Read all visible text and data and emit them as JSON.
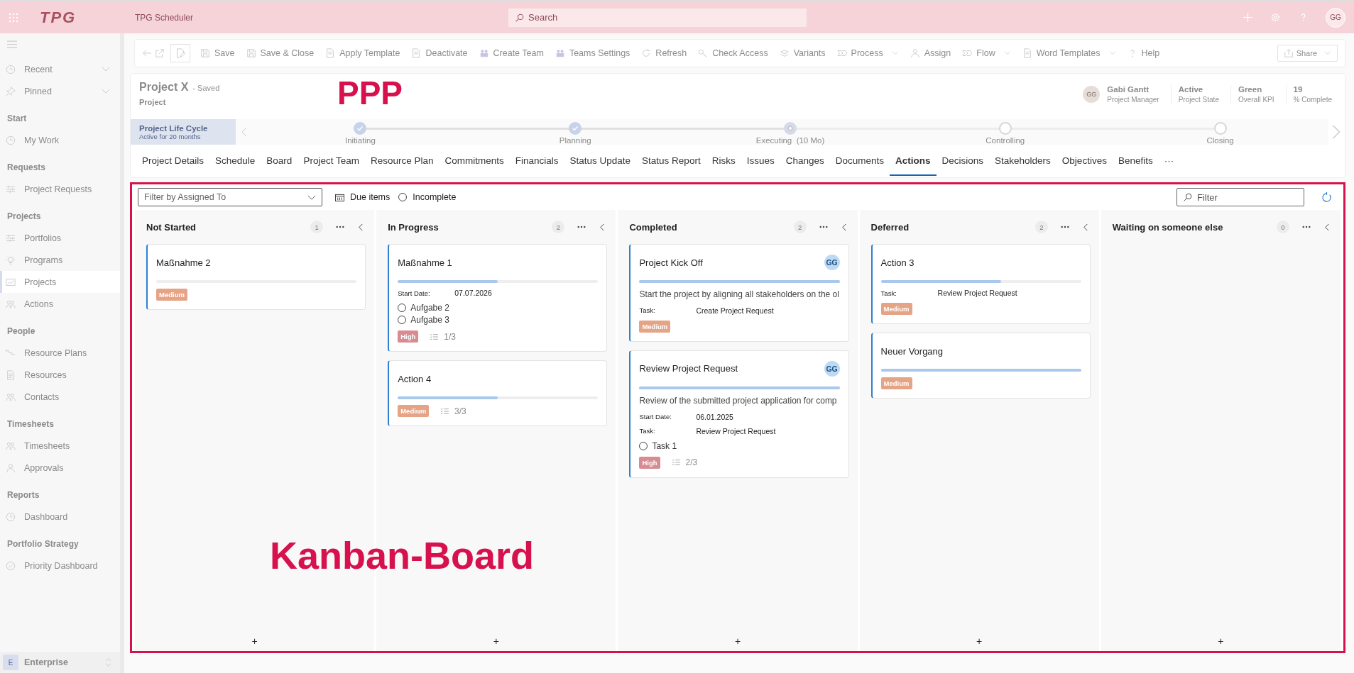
{
  "top_bar": {
    "logo": "TPG",
    "app_name": "TPG Scheduler",
    "search": {
      "placeholder": "Search"
    },
    "avatar": "GG"
  },
  "toolbar": {
    "items": [
      {
        "label": "Save",
        "dropdown": false
      },
      {
        "label": "Save & Close",
        "dropdown": false
      },
      {
        "label": "Apply Template",
        "dropdown": false
      },
      {
        "label": "Deactivate",
        "dropdown": false
      },
      {
        "label": "Create Team",
        "dropdown": false
      },
      {
        "label": "Teams Settings",
        "dropdown": false
      },
      {
        "label": "Refresh",
        "dropdown": false
      },
      {
        "label": "Check Access",
        "dropdown": false
      },
      {
        "label": "Variants",
        "dropdown": false
      },
      {
        "label": "Process",
        "dropdown": true
      },
      {
        "label": "Assign",
        "dropdown": false
      },
      {
        "label": "Flow",
        "dropdown": true
      },
      {
        "label": "Word Templates",
        "dropdown": true
      },
      {
        "label": "Help",
        "dropdown": false
      }
    ],
    "share": "Share"
  },
  "header": {
    "title": "Project X",
    "status": "- Saved",
    "subtitle": "Project",
    "owner": {
      "initials": "GG",
      "name": "Gabi Gantt",
      "role": "Project Manager"
    },
    "stats": [
      {
        "value": "Active",
        "label": "Project State"
      },
      {
        "value": "Green",
        "label": "Overall KPI"
      },
      {
        "value": "19",
        "label": "% Complete"
      }
    ]
  },
  "lifecycle": {
    "title": "Project Life Cycle",
    "subtitle": "Active for 20 months",
    "stages": [
      {
        "label": "Initiating",
        "completed": true,
        "selected": false
      },
      {
        "label": "Planning",
        "completed": true,
        "selected": false
      },
      {
        "label": "Executing  (10 Mo)",
        "completed": false,
        "selected": true
      },
      {
        "label": "Controlling",
        "completed": false,
        "selected": false
      },
      {
        "label": "Closing",
        "completed": false,
        "selected": false
      }
    ]
  },
  "tabs": [
    {
      "label": "Project Details",
      "selected": false
    },
    {
      "label": "Schedule",
      "selected": false
    },
    {
      "label": "Board",
      "selected": false
    },
    {
      "label": "Project Team",
      "selected": false
    },
    {
      "label": "Resource Plan",
      "selected": false
    },
    {
      "label": "Commitments",
      "selected": false
    },
    {
      "label": "Financials",
      "selected": false
    },
    {
      "label": "Status Update",
      "selected": false
    },
    {
      "label": "Status Report",
      "selected": false
    },
    {
      "label": "Risks",
      "selected": false
    },
    {
      "label": "Issues",
      "selected": false
    },
    {
      "label": "Changes",
      "selected": false
    },
    {
      "label": "Documents",
      "selected": false
    },
    {
      "label": "Actions",
      "selected": true
    },
    {
      "label": "Decisions",
      "selected": false
    },
    {
      "label": "Stakeholders",
      "selected": false
    },
    {
      "label": "Objectives",
      "selected": false
    },
    {
      "label": "Benefits",
      "selected": false
    }
  ],
  "more_tabs": "···",
  "sidebar": {
    "top": [
      {
        "label": "Recent"
      },
      {
        "label": "Pinned"
      }
    ],
    "sections": [
      {
        "title": "Start",
        "items": [
          {
            "label": "My Work",
            "selected": false
          }
        ]
      },
      {
        "title": "Requests",
        "items": [
          {
            "label": "Project Requests",
            "selected": false
          }
        ]
      },
      {
        "title": "Projects",
        "items": [
          {
            "label": "Portfolios",
            "selected": false
          },
          {
            "label": "Programs",
            "selected": false
          },
          {
            "label": "Projects",
            "selected": true
          },
          {
            "label": "Actions",
            "selected": false
          }
        ]
      },
      {
        "title": "People",
        "items": [
          {
            "label": "Resource Plans",
            "selected": false
          },
          {
            "label": "Resources",
            "selected": false
          },
          {
            "label": "Contacts",
            "selected": false
          }
        ]
      },
      {
        "title": "Timesheets",
        "items": [
          {
            "label": "Timesheets",
            "selected": false
          },
          {
            "label": "Approvals",
            "selected": false
          }
        ]
      },
      {
        "title": "Reports",
        "items": [
          {
            "label": "Dashboard",
            "selected": false
          }
        ]
      },
      {
        "title": "Portfolio Strategy",
        "items": [
          {
            "label": "Priority Dashboard",
            "selected": false
          }
        ]
      }
    ],
    "footer": {
      "badge": "E",
      "label": "Enterprise"
    }
  },
  "board": {
    "filter_dropdown": {
      "placeholder": "Filter by Assigned To"
    },
    "due_items": "Due items",
    "incomplete": {
      "label": "Incomplete",
      "checked": false
    },
    "filter_field": {
      "placeholder": "Filter"
    },
    "columns": [
      {
        "title": "Not Started",
        "count": "1",
        "add_button": "+",
        "cards": [
          {
            "title": "Maßnahme 2",
            "level": 0,
            "priority": {
              "label": "Medium",
              "color": "#e6a487"
            }
          }
        ]
      },
      {
        "title": "In Progress",
        "count": "2",
        "add_button": "+",
        "cards": [
          {
            "title": "Maßnahme 1",
            "level": 0.5,
            "fields": [
              {
                "label": "Start Date:",
                "value": "07.07.2026"
              }
            ],
            "tasks": [
              {
                "label": "Aufgabe 2",
                "checked": false
              },
              {
                "label": "Aufgabe 3",
                "checked": false
              }
            ],
            "priority": {
              "label": "High",
              "color": "#d88c91"
            },
            "checklist": "1/3"
          },
          {
            "title": "Action 4",
            "level": 0.5,
            "priority": {
              "label": "Medium",
              "color": "#e6a487"
            },
            "checklist": "3/3"
          }
        ]
      },
      {
        "title": "Completed",
        "count": "2",
        "add_button": "+",
        "cards": [
          {
            "title": "Project Kick Off",
            "avatar": "GG",
            "level": 1,
            "description": "Start the project by aligning all stakeholders on the ol",
            "fields": [
              {
                "label": "Task:",
                "value": "Create Project Request"
              }
            ],
            "priority": {
              "label": "Medium",
              "color": "#e6a487"
            }
          },
          {
            "title": "Review Project Request",
            "avatar": "GG",
            "level": 1,
            "description": "Review of the submitted project application for comp",
            "fields": [
              {
                "label": "Start Date:",
                "value": "06.01.2025"
              },
              {
                "label": "Task:",
                "value": "Review Project Request"
              }
            ],
            "tasks": [
              {
                "label": "Task 1",
                "checked": false
              }
            ],
            "priority": {
              "label": "High",
              "color": "#d88c91"
            },
            "checklist": "2/3"
          }
        ]
      },
      {
        "title": "Deferred",
        "count": "2",
        "add_button": "+",
        "cards": [
          {
            "title": "Action 3",
            "level": 0.6,
            "fields": [
              {
                "label": "Task:",
                "value": "Review Project Request"
              }
            ],
            "priority": {
              "label": "Medium",
              "color": "#e6a487"
            }
          },
          {
            "title": "Neuer Vorgang",
            "level": 1,
            "priority": {
              "label": "Medium",
              "color": "#e6a487"
            }
          }
        ]
      },
      {
        "title": "Waiting on someone else",
        "count": "0",
        "add_button": "+"
      }
    ]
  },
  "annotations": [
    {
      "text": "PPP"
    },
    {
      "text": "Kanban-Board"
    }
  ]
}
